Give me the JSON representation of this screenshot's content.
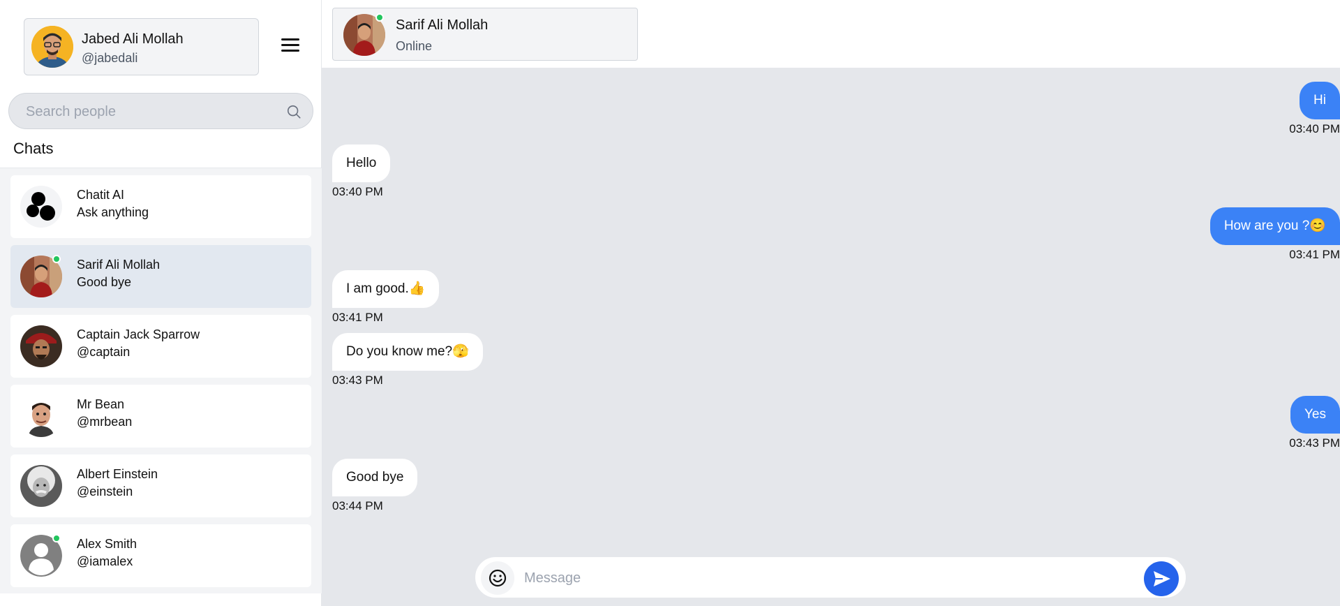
{
  "colors": {
    "accent": "#3b82f6",
    "send": "#2563eb",
    "online": "#22c55e",
    "chat_bg": "#e5e7eb"
  },
  "user": {
    "name": "Jabed Ali Mollah",
    "handle": "@jabedali"
  },
  "search": {
    "placeholder": "Search people"
  },
  "chats_heading": "Chats",
  "chats": [
    {
      "name": "Chatit AI",
      "sub": "Ask anything",
      "icon": "chatit-logo-icon"
    },
    {
      "name": "Sarif Ali Mollah",
      "sub": "Good bye",
      "online": true,
      "active": true
    },
    {
      "name": "Captain Jack Sparrow",
      "sub": "@captain"
    },
    {
      "name": "Mr Bean",
      "sub": "@mrbean"
    },
    {
      "name": "Albert Einstein",
      "sub": "@einstein"
    },
    {
      "name": "Alex Smith",
      "sub": "@iamalex",
      "online": true
    }
  ],
  "contact": {
    "name": "Sarif Ali Mollah",
    "status": "Online"
  },
  "messages": [
    {
      "dir": "out",
      "text": "Hi",
      "time": "03:40 PM"
    },
    {
      "dir": "in",
      "text": "Hello",
      "time": "03:40 PM"
    },
    {
      "dir": "out",
      "text": "How are you ?😊",
      "time": "03:41 PM"
    },
    {
      "dir": "in",
      "text": "I am good.👍",
      "time": "03:41 PM"
    },
    {
      "dir": "in",
      "text": "Do you know me?🫣",
      "time": "03:43 PM"
    },
    {
      "dir": "out",
      "text": "Yes",
      "time": "03:43 PM"
    },
    {
      "dir": "in",
      "text": "Good bye",
      "time": "03:44 PM"
    }
  ],
  "composer": {
    "placeholder": "Message"
  }
}
